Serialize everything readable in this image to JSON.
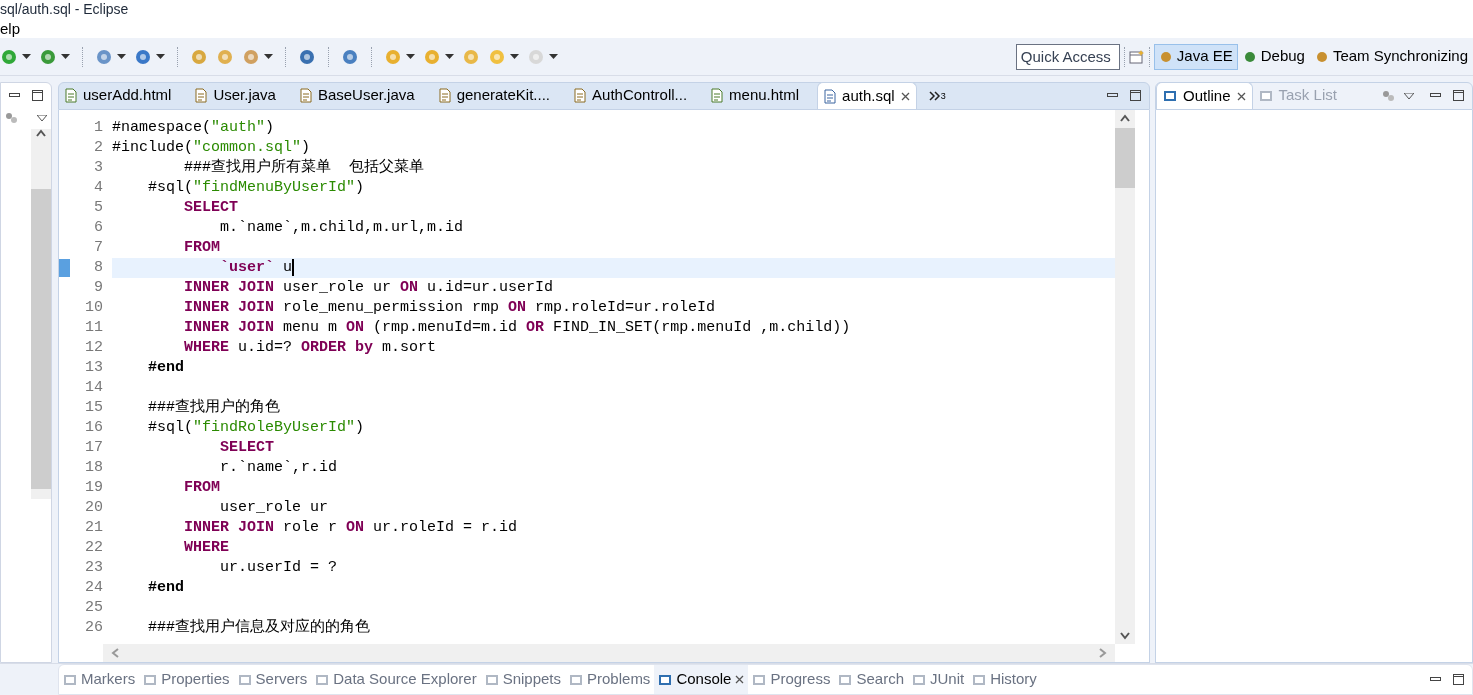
{
  "window": {
    "title": "sql/auth.sql - Eclipse"
  },
  "menu": [
    "elp"
  ],
  "quick_access": {
    "placeholder": "Quick Access"
  },
  "perspectives": [
    {
      "label": "Java EE",
      "selected": true
    },
    {
      "label": "Debug",
      "selected": false
    },
    {
      "label": "Team Synchronizing",
      "selected": false
    }
  ],
  "editor_tabs": [
    {
      "label": "userAdd.html",
      "kind": "html",
      "selected": false
    },
    {
      "label": "User.java",
      "kind": "java",
      "selected": false
    },
    {
      "label": "BaseUser.java",
      "kind": "java",
      "selected": false
    },
    {
      "label": "generateKit....",
      "kind": "java",
      "selected": false
    },
    {
      "label": "AuthControll...",
      "kind": "java",
      "selected": false
    },
    {
      "label": "menu.html",
      "kind": "html",
      "selected": false
    },
    {
      "label": "auth.sql",
      "kind": "sql",
      "selected": true
    }
  ],
  "hidden_tabs_count": "3",
  "code_lines": [
    {
      "number": "1",
      "current": false,
      "tokens": [
        {
          "kind": "plain",
          "text": "#namespace("
        },
        {
          "kind": "string",
          "text": "\"auth\""
        },
        {
          "kind": "plain",
          "text": ")"
        }
      ]
    },
    {
      "number": "2",
      "current": false,
      "tokens": [
        {
          "kind": "plain",
          "text": "#include("
        },
        {
          "kind": "string",
          "text": "\"common.sql\""
        },
        {
          "kind": "plain",
          "text": ")"
        }
      ]
    },
    {
      "number": "3",
      "current": false,
      "tokens": [
        {
          "kind": "plain",
          "text": "        ###查找用户所有菜单  包括父菜单"
        }
      ]
    },
    {
      "number": "4",
      "current": false,
      "tokens": [
        {
          "kind": "plain",
          "text": "    #sql("
        },
        {
          "kind": "string",
          "text": "\"findMenuByUserId\""
        },
        {
          "kind": "plain",
          "text": ")"
        }
      ]
    },
    {
      "number": "5",
      "current": false,
      "tokens": [
        {
          "kind": "keyword",
          "text": "        SELECT"
        }
      ]
    },
    {
      "number": "6",
      "current": false,
      "tokens": [
        {
          "kind": "plain",
          "text": "            m.`name`,m.child,m.url,m.id"
        }
      ]
    },
    {
      "number": "7",
      "current": false,
      "tokens": [
        {
          "kind": "keyword",
          "text": "        FROM"
        }
      ]
    },
    {
      "number": "8",
      "current": true,
      "tokens": [
        {
          "kind": "keyword",
          "text": "            `user`"
        },
        {
          "kind": "plain",
          "text": " u"
        }
      ]
    },
    {
      "number": "9",
      "current": false,
      "tokens": [
        {
          "kind": "keyword",
          "text": "        INNER JOIN"
        },
        {
          "kind": "plain",
          "text": " user_role ur "
        },
        {
          "kind": "keyword",
          "text": "ON"
        },
        {
          "kind": "plain",
          "text": " u.id=ur.userId"
        }
      ]
    },
    {
      "number": "10",
      "current": false,
      "tokens": [
        {
          "kind": "keyword",
          "text": "        INNER JOIN"
        },
        {
          "kind": "plain",
          "text": " role_menu_permission rmp "
        },
        {
          "kind": "keyword",
          "text": "ON"
        },
        {
          "kind": "plain",
          "text": " rmp.roleId=ur.roleId"
        }
      ]
    },
    {
      "number": "11",
      "current": false,
      "tokens": [
        {
          "kind": "keyword",
          "text": "        INNER JOIN"
        },
        {
          "kind": "plain",
          "text": " menu m "
        },
        {
          "kind": "keyword",
          "text": "ON"
        },
        {
          "kind": "plain",
          "text": " (rmp.menuId=m.id "
        },
        {
          "kind": "keyword",
          "text": "OR"
        },
        {
          "kind": "plain",
          "text": " FIND_IN_SET(rmp.menuId ,m.child))"
        }
      ]
    },
    {
      "number": "12",
      "current": false,
      "tokens": [
        {
          "kind": "keyword",
          "text": "        WHERE"
        },
        {
          "kind": "plain",
          "text": " u.id=? "
        },
        {
          "kind": "keyword",
          "text": "ORDER by"
        },
        {
          "kind": "plain",
          "text": " m.sort"
        }
      ]
    },
    {
      "number": "13",
      "current": false,
      "tokens": [
        {
          "kind": "directive",
          "text": "    #end"
        }
      ]
    },
    {
      "number": "14",
      "current": false
    },
    {
      "number": "15",
      "current": false,
      "tokens": [
        {
          "kind": "plain",
          "text": "    ###查找用户的角色"
        }
      ]
    },
    {
      "number": "16",
      "current": false,
      "tokens": [
        {
          "kind": "plain",
          "text": "    #sql("
        },
        {
          "kind": "string",
          "text": "\"findRoleByUserId\""
        },
        {
          "kind": "plain",
          "text": ")"
        }
      ]
    },
    {
      "number": "17",
      "current": false,
      "tokens": [
        {
          "kind": "keyword",
          "text": "            SELECT"
        }
      ]
    },
    {
      "number": "18",
      "current": false,
      "tokens": [
        {
          "kind": "plain",
          "text": "            r.`name`,r.id"
        }
      ]
    },
    {
      "number": "19",
      "current": false,
      "tokens": [
        {
          "kind": "keyword",
          "text": "        FROM"
        }
      ]
    },
    {
      "number": "20",
      "current": false,
      "tokens": [
        {
          "kind": "plain",
          "text": "            user_role ur"
        }
      ]
    },
    {
      "number": "21",
      "current": false,
      "tokens": [
        {
          "kind": "keyword",
          "text": "        INNER JOIN"
        },
        {
          "kind": "plain",
          "text": " role r "
        },
        {
          "kind": "keyword",
          "text": "ON"
        },
        {
          "kind": "plain",
          "text": " ur.roleId = r.id"
        }
      ]
    },
    {
      "number": "22",
      "current": false,
      "tokens": [
        {
          "kind": "keyword",
          "text": "        WHERE"
        }
      ]
    },
    {
      "number": "23",
      "current": false,
      "tokens": [
        {
          "kind": "plain",
          "text": "            ur.userId = ?"
        }
      ]
    },
    {
      "number": "24",
      "current": false,
      "tokens": [
        {
          "kind": "directive",
          "text": "    #end"
        }
      ]
    },
    {
      "number": "25",
      "current": false
    },
    {
      "number": "26",
      "current": false,
      "tokens": [
        {
          "kind": "plain",
          "text": "    ###查找用户信息及对应的的角色"
        }
      ]
    }
  ],
  "side_tabs": [
    {
      "label": "Outline",
      "selected": true
    },
    {
      "label": "Task List",
      "selected": false
    }
  ],
  "bottom_tabs": [
    {
      "label": "Markers",
      "selected": false
    },
    {
      "label": "Properties",
      "selected": false
    },
    {
      "label": "Servers",
      "selected": false
    },
    {
      "label": "Data Source Explorer",
      "selected": false
    },
    {
      "label": "Snippets",
      "selected": false
    },
    {
      "label": "Problems",
      "selected": false
    },
    {
      "label": "Console",
      "selected": true
    },
    {
      "label": "Progress",
      "selected": false
    },
    {
      "label": "Search",
      "selected": false
    },
    {
      "label": "JUnit",
      "selected": false
    },
    {
      "label": "History",
      "selected": false
    }
  ]
}
